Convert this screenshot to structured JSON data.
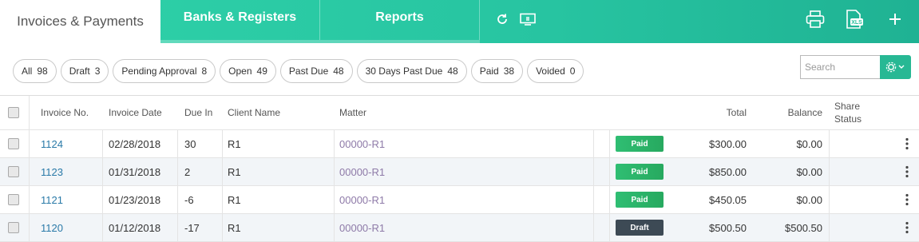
{
  "tabs": {
    "active": "Invoices & Payments",
    "banks": "Banks & Registers",
    "reports": "Reports"
  },
  "toolbar_icons": [
    "refresh-icon",
    "screen-icon",
    "print-icon",
    "xls-export-icon",
    "add-icon"
  ],
  "filters": [
    {
      "label": "All",
      "count": "98"
    },
    {
      "label": "Draft",
      "count": "3"
    },
    {
      "label": "Pending Approval",
      "count": "8"
    },
    {
      "label": "Open",
      "count": "49"
    },
    {
      "label": "Past Due",
      "count": "48"
    },
    {
      "label": "30 Days Past Due",
      "count": "48"
    },
    {
      "label": "Paid",
      "count": "38"
    },
    {
      "label": "Voided",
      "count": "0"
    }
  ],
  "search": {
    "placeholder": "Search"
  },
  "columns": {
    "invoice_no": "Invoice No.",
    "invoice_date": "Invoice Date",
    "due_in": "Due In",
    "client_name": "Client Name",
    "matter": "Matter",
    "total": "Total",
    "balance": "Balance",
    "share_status_1": "Share",
    "share_status_2": "Status"
  },
  "rows": [
    {
      "invoice_no": "1124",
      "invoice_date": "02/28/2018",
      "due_in": "30",
      "client": "R1",
      "matter": "00000-R1",
      "status": "Paid",
      "total": "$300.00",
      "balance": "$0.00"
    },
    {
      "invoice_no": "1123",
      "invoice_date": "01/31/2018",
      "due_in": "2",
      "client": "R1",
      "matter": "00000-R1",
      "status": "Paid",
      "total": "$850.00",
      "balance": "$0.00"
    },
    {
      "invoice_no": "1121",
      "invoice_date": "01/23/2018",
      "due_in": "-6",
      "client": "R1",
      "matter": "00000-R1",
      "status": "Paid",
      "total": "$450.05",
      "balance": "$0.00"
    },
    {
      "invoice_no": "1120",
      "invoice_date": "01/12/2018",
      "due_in": "-17",
      "client": "R1",
      "matter": "00000-R1",
      "status": "Draft",
      "total": "$500.50",
      "balance": "$500.50"
    }
  ],
  "colors": {
    "accent": "#2fd2a9",
    "paid": "#2fbe73",
    "draft": "#3d4a55",
    "link": "#2a7aa8"
  }
}
